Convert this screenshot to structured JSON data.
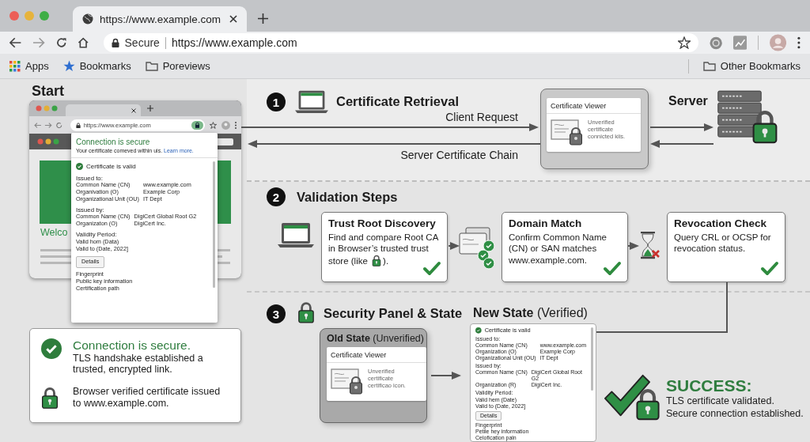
{
  "browser": {
    "tabs": [
      {
        "title": "https://www.example.com",
        "selected": true
      }
    ],
    "address": {
      "security": "Secure",
      "url": "https://www.example.com"
    },
    "bookmarks": [
      {
        "label": "Apps",
        "kind": "apps"
      },
      {
        "label": "Bookmarks",
        "kind": "star"
      },
      {
        "label": "Poreviews",
        "kind": "folder"
      }
    ],
    "other_bookmarks": "Other Bookmarks"
  },
  "start": {
    "title": "Start",
    "window": {
      "url": "https://www.example.com",
      "page_heading": "Welco"
    },
    "popup": {
      "title": "Connection is secure",
      "subtitle": "Your certificate comeved within uis.",
      "link": "Learn more.",
      "certificate": {
        "status": "Certificate is valid",
        "issued_to": {
          "heading": "Issued to:",
          "rows": [
            {
              "label": "Common Name (CN)",
              "value": "www.example.com"
            },
            {
              "label": "Organivation (O)",
              "value": "Example Corp"
            },
            {
              "label": "Organizational Unit (OU)",
              "value": "IT Dept"
            }
          ]
        },
        "issued_by": {
          "heading": "Issued by:",
          "rows": [
            {
              "label": "Common Name (CN)",
              "value": "DigiCert Global Root G2"
            },
            {
              "label": "Organizaton (O)",
              "value": "DigiCert Inc."
            }
          ]
        },
        "validity": {
          "heading": "Validity Period:",
          "lines": [
            "Valid hom (Data)",
            "Valid to (Date, 2022]"
          ]
        },
        "button": "Details",
        "footer": [
          "Fingerprint",
          "Public key information",
          "Certification path"
        ]
      }
    }
  },
  "step1": {
    "number": "1",
    "title": "Certificate Retrieval",
    "request_label": "Client Request",
    "response_label": "Server Certificate Chain",
    "viewer": {
      "title": "Certificate Viewer",
      "status": "Unverified certificate connicted kiis."
    },
    "server_label": "Server"
  },
  "step2": {
    "number": "2",
    "title": "Validation Steps",
    "cards": [
      {
        "title": "Trust Root Discovery",
        "text": "Find and compare Root CA in Browser’s trusted trust store (like",
        "text_end": ").",
        "checked": true
      },
      {
        "title": "Domain Match",
        "text": "Confirm Common Name (CN) or SAN matches www.example.com.",
        "checked": true
      },
      {
        "title": "Revocation Check",
        "text": "Query CRL or OCSP for revocation status.",
        "checked": true
      }
    ]
  },
  "step3": {
    "number": "3",
    "title": "Security Panel & State",
    "old_state": {
      "title": "Old State",
      "qualifier": "(Unverified)",
      "viewer": {
        "title": "Certificate Viewer",
        "status": "Unverified certificate certificao icon."
      }
    },
    "new_state": {
      "title": "New State",
      "qualifier": "(Verified)",
      "certificate": {
        "status": "Certificate is valid",
        "issued_to": {
          "heading": "Issued to:",
          "rows": [
            {
              "label": "Common Name (CN)",
              "value": "www.example.com"
            },
            {
              "label": "Organization (O)",
              "value": "Example Corp"
            },
            {
              "label": "Organizational Unit (OU)",
              "value": "IT Dept"
            }
          ]
        },
        "issued_by": {
          "heading": "Issued by:",
          "rows": [
            {
              "label": "Common Name (CN)",
              "value": "DigiCert Global Root G2"
            },
            {
              "label": "Organization (R)",
              "value": "DigiCert Inc."
            }
          ]
        },
        "validity": {
          "heading": "Validity Period:",
          "lines": [
            "Valid hem (Date)",
            "Valid to (Date, 2022]"
          ]
        },
        "button": "Details",
        "footer": [
          "Fingerprint",
          "Petile hey information",
          "Celofication paln"
        ]
      }
    }
  },
  "summary": {
    "headline": "Connection is secure.",
    "detail": "TLS handshake established a trusted, encrypted link.",
    "note": "Browser verified certificate issued to www.example.com."
  },
  "success": {
    "title": "SUCCESS:",
    "lines": [
      "TLS certificate validated.",
      "Secure connection established."
    ]
  }
}
